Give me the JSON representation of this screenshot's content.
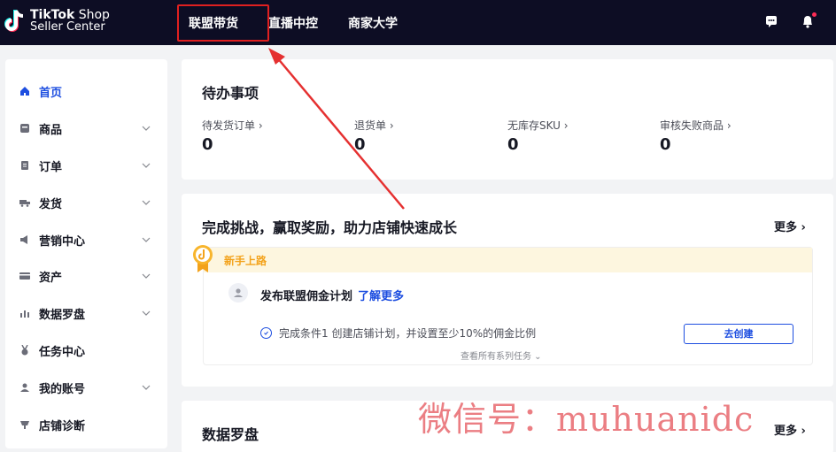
{
  "header": {
    "logo_brand": "TikTok",
    "logo_suffix": "Shop",
    "logo_sub": "Seller Center",
    "nav": [
      "联盟带货",
      "直播中控",
      "商家大学"
    ]
  },
  "sidebar": {
    "items": [
      {
        "label": "首页",
        "icon": "home-icon"
      },
      {
        "label": "商品",
        "icon": "product-icon"
      },
      {
        "label": "订单",
        "icon": "order-icon"
      },
      {
        "label": "发货",
        "icon": "truck-icon"
      },
      {
        "label": "营销中心",
        "icon": "megaphone-icon"
      },
      {
        "label": "资产",
        "icon": "card-icon"
      },
      {
        "label": "数据罗盘",
        "icon": "chart-icon"
      },
      {
        "label": "任务中心",
        "icon": "medal-icon"
      },
      {
        "label": "我的账号",
        "icon": "user-icon"
      },
      {
        "label": "店铺诊断",
        "icon": "diagnose-icon"
      }
    ]
  },
  "todo": {
    "title": "待办事项",
    "items": [
      {
        "label": "待发货订单 ›",
        "value": "0"
      },
      {
        "label": "退货单 ›",
        "value": "0"
      },
      {
        "label": "无库存SKU ›",
        "value": "0"
      },
      {
        "label": "审核失败商品 ›",
        "value": "0"
      }
    ]
  },
  "growth": {
    "title": "完成挑战，赢取奖励，助力店铺快速成长",
    "more": "更多 ›",
    "newbie_label": "新手上路",
    "task_title": "发布联盟佣金计划",
    "task_link": "了解更多",
    "task_condition": "完成条件1 创建店铺计划，并设置至少10%的佣金比例",
    "create_button": "去创建",
    "view_all": "查看所有系列任务 ⌄"
  },
  "compass": {
    "title": "数据罗盘",
    "more": "更多 ›"
  },
  "watermark": "微信号：muhuanidc",
  "colors": {
    "topbar": "#0d0d24",
    "accent": "#1d4ee0",
    "highlight_red": "#e02020",
    "newbie_orange": "#f3a21a"
  }
}
